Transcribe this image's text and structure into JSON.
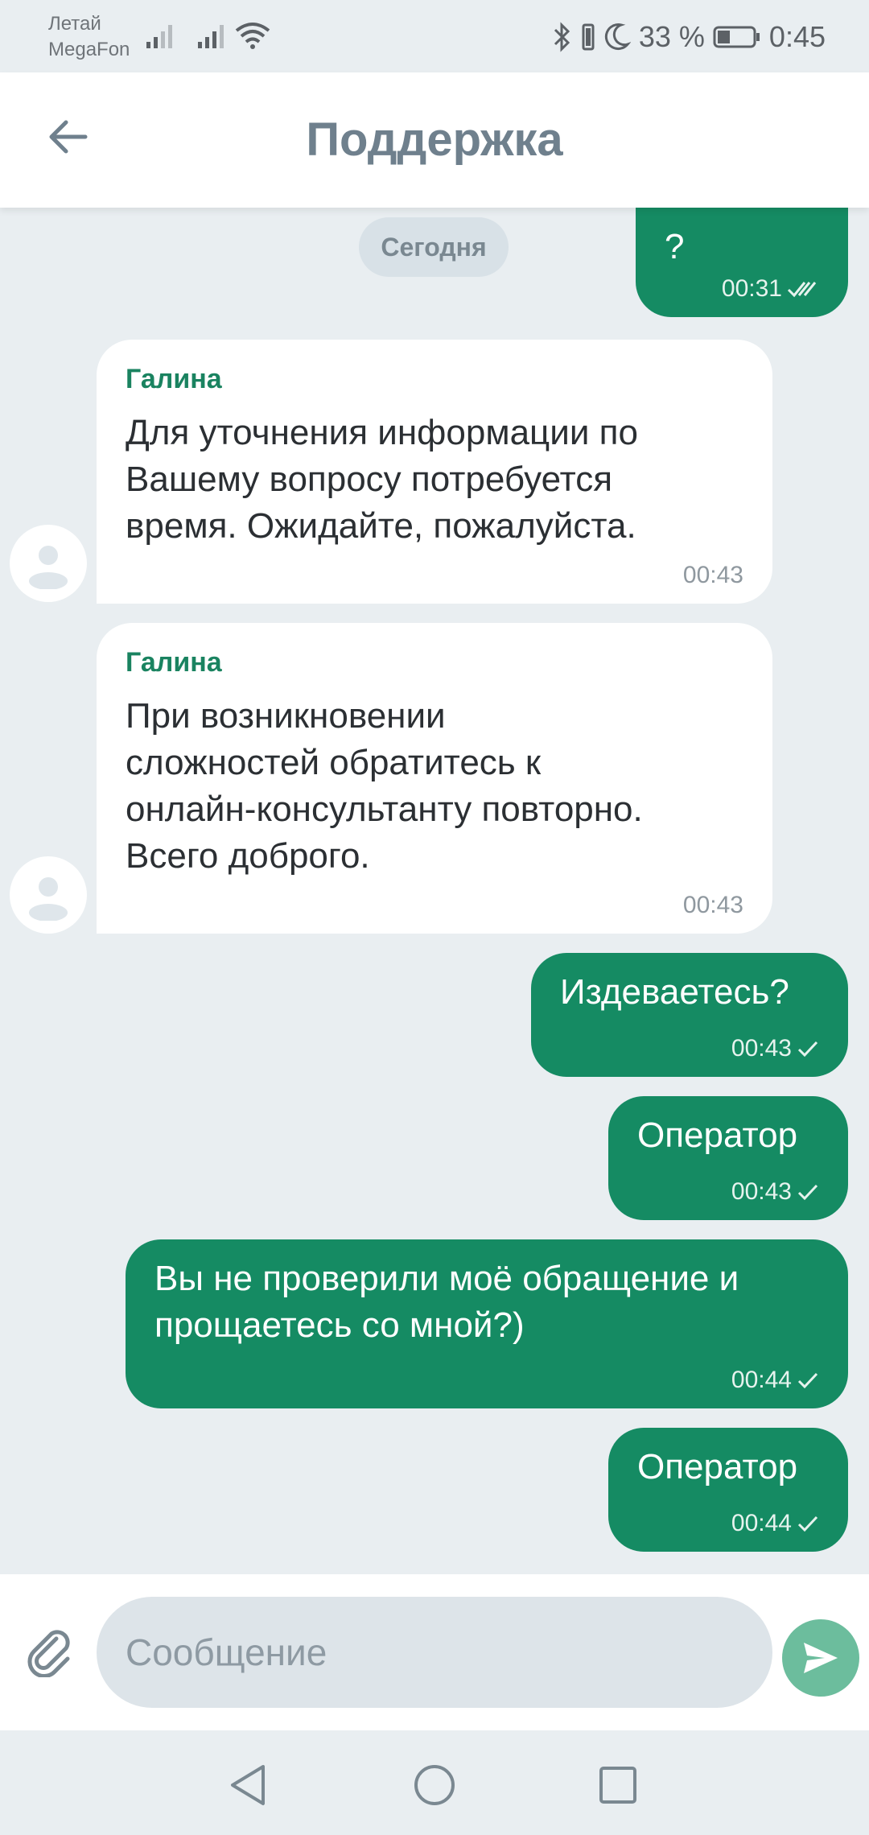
{
  "status_bar": {
    "carrier_line1": "Летай",
    "carrier_line2": "MegaFon",
    "battery_percent": "33 %",
    "time": "0:45"
  },
  "header": {
    "title": "Поддержка"
  },
  "chat": {
    "date_label": "Сегодня",
    "messages": [
      {
        "direction": "out",
        "text": "?",
        "time": "00:31",
        "status": "read"
      },
      {
        "direction": "in",
        "sender": "Галина",
        "lines": [
          "Для уточнения информации по",
          "Вашему вопросу потребуется",
          "время.  Ожидайте, пожалуйста."
        ],
        "time": "00:43"
      },
      {
        "direction": "in",
        "sender": "Галина",
        "lines": [
          "При возникновении",
          "сложностей обратитесь к",
          "онлайн-консультанту повторно.",
          "Всего доброго."
        ],
        "time": "00:43"
      },
      {
        "direction": "out",
        "text": "Издеваетесь?",
        "time": "00:43",
        "status": "sent"
      },
      {
        "direction": "out",
        "text": "Оператор",
        "time": "00:43",
        "status": "sent"
      },
      {
        "direction": "out",
        "lines": [
          "Вы не проверили моё обращение и",
          "прощаетесь со мной?)"
        ],
        "time": "00:44",
        "status": "sent"
      },
      {
        "direction": "out",
        "text": "Оператор",
        "time": "00:44",
        "status": "sent"
      }
    ]
  },
  "composer": {
    "placeholder": "Сообщение",
    "value": ""
  },
  "colors": {
    "accent": "#158b63",
    "send_button": "#6cbd9d",
    "sender_name": "#1a8360",
    "title": "#6f808d"
  },
  "icons": {
    "back": "arrow-left-icon",
    "attach": "paperclip-icon",
    "send": "send-icon",
    "read": "double-check-icon",
    "sent": "check-icon",
    "avatar": "user-avatar-icon"
  }
}
